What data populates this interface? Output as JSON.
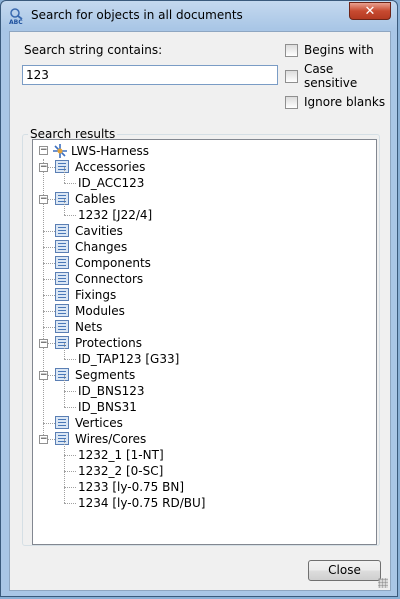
{
  "window": {
    "title": "Search for objects in all documents",
    "close_label": "✕"
  },
  "search": {
    "label": "Search string contains:",
    "value": "123",
    "placeholder": ""
  },
  "options": [
    {
      "label": "Begins with",
      "checked": false
    },
    {
      "label": "Case sensitive",
      "checked": false
    },
    {
      "label": "Ignore blanks",
      "checked": false
    }
  ],
  "results": {
    "label": "Search results",
    "root": "LWS-Harness",
    "rows": [
      {
        "text": "Accessories",
        "type": "folder",
        "expanded": true
      },
      {
        "text": "ID_ACC123",
        "type": "leaf"
      },
      {
        "text": "Cables",
        "type": "folder",
        "expanded": true
      },
      {
        "text": "1232 [J22/4]",
        "type": "leaf"
      },
      {
        "text": "Cavities",
        "type": "folder"
      },
      {
        "text": "Changes",
        "type": "folder"
      },
      {
        "text": "Components",
        "type": "folder"
      },
      {
        "text": "Connectors",
        "type": "folder"
      },
      {
        "text": "Fixings",
        "type": "folder"
      },
      {
        "text": "Modules",
        "type": "folder"
      },
      {
        "text": "Nets",
        "type": "folder"
      },
      {
        "text": "Protections",
        "type": "folder",
        "expanded": true
      },
      {
        "text": "ID_TAP123 [G33]",
        "type": "leaf"
      },
      {
        "text": "Segments",
        "type": "folder",
        "expanded": true
      },
      {
        "text": "ID_BNS123",
        "type": "leaf"
      },
      {
        "text": "ID_BNS31",
        "type": "leaf"
      },
      {
        "text": "Vertices",
        "type": "folder"
      },
      {
        "text": "Wires/Cores",
        "type": "folder",
        "expanded": true
      },
      {
        "text": "1232_1 [1-NT]",
        "type": "leaf"
      },
      {
        "text": "1232_2 [0-SC]",
        "type": "leaf"
      },
      {
        "text": "1233 [ly-0.75 BN]",
        "type": "leaf"
      },
      {
        "text": "1234 [ly-0.75 RD/BU]",
        "type": "leaf"
      }
    ]
  },
  "buttons": {
    "close": "Close"
  }
}
